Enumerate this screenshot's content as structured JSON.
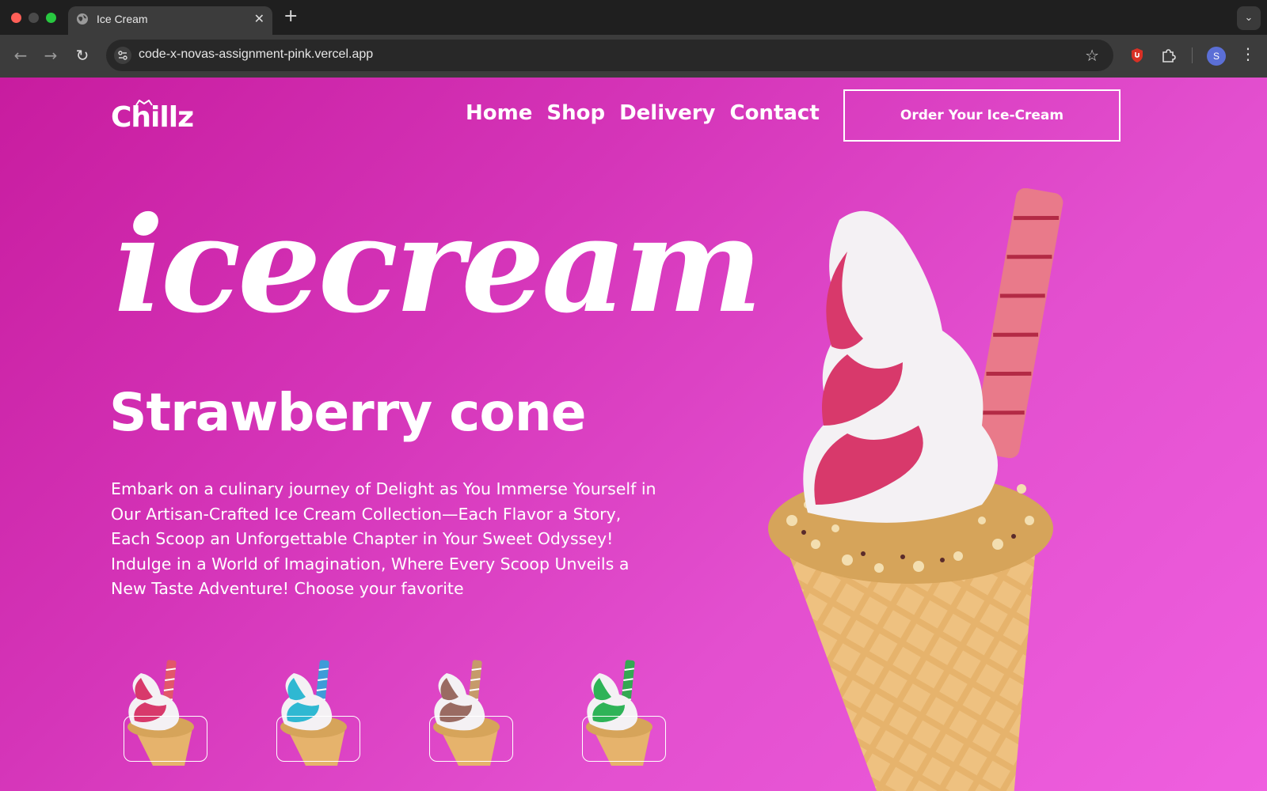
{
  "browser": {
    "tab_title": "Ice Cream",
    "tab_close": "✕",
    "new_tab": "+",
    "url": "code-x-novas-assignment-pink.vercel.app",
    "avatar_letter": "S",
    "icons": [
      "globe-icon",
      "back-icon",
      "forward-icon",
      "reload-icon",
      "site-info-icon",
      "star-icon",
      "extension-icon",
      "puzzle-icon",
      "menu-icon"
    ]
  },
  "site": {
    "logo": "Chillz",
    "nav": [
      "Home",
      "Shop",
      "Delivery",
      "Contact"
    ],
    "cta": "Order Your Ice-Cream",
    "script_title": "icecream",
    "subtitle": "Strawberry cone",
    "description": "Embark on a culinary journey of Delight as You Immerse Yourself in Our Artisan-Crafted Ice Cream Collection—Each Flavor a Story, Each Scoop an Unforgettable Chapter in Your Sweet Odyssey! Indulge in a World of Imagination, Where Every Scoop Unveils a New Taste Adventure! Choose your favorite",
    "flavors": [
      {
        "name": "strawberry",
        "swirl": "#d8396b",
        "wafer": "#e2566b"
      },
      {
        "name": "blueberry",
        "swirl": "#2fb8d2",
        "wafer": "#3f9bd8"
      },
      {
        "name": "chocolate",
        "swirl": "#9a6b62",
        "wafer": "#c69a6a"
      },
      {
        "name": "mint",
        "swirl": "#2eb357",
        "wafer": "#34a852"
      }
    ],
    "colors": {
      "gradient_start": "#c81c9f",
      "gradient_end": "#ef5fdf",
      "cone": "#e7b46a",
      "cream_white": "#f4f1f4",
      "cream_pink": "#d8396b"
    }
  }
}
